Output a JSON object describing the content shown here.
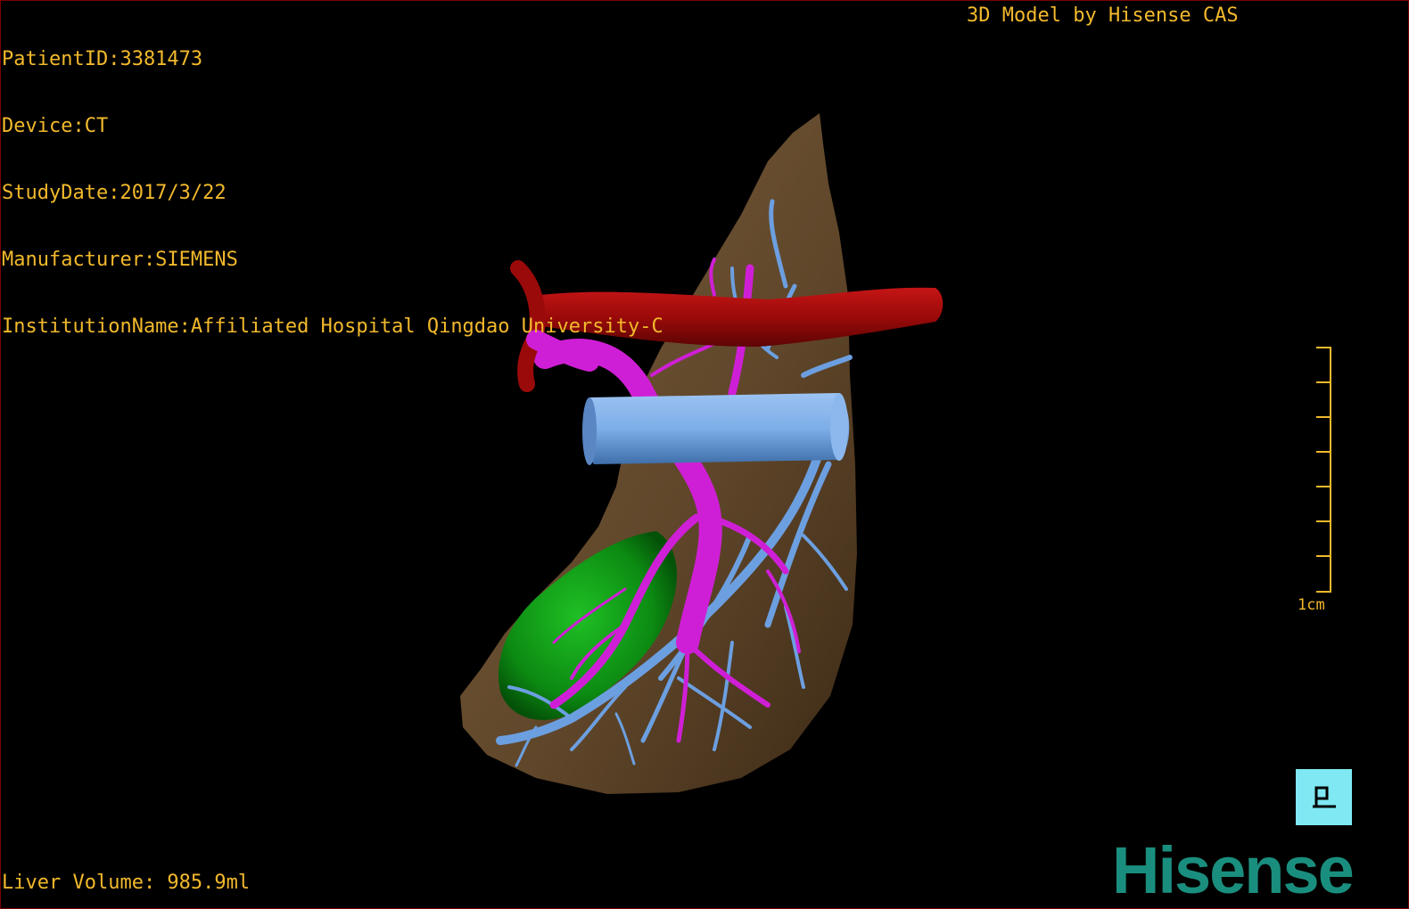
{
  "patient_info": {
    "patient_id": "PatientID:3381473",
    "device": "Device:CT",
    "study_date": "StudyDate:2017/3/22",
    "manufacturer": "Manufacturer:SIEMENS",
    "institution": "InstitutionName:Affiliated Hospital Qingdao University-C"
  },
  "model_credit": "3D Model by Hisense CAS",
  "liver_volume": "Liver Volume: 985.9ml",
  "scale_label": "1cm",
  "brand": "Hisense",
  "orientation_icon": "posterior-view-icon",
  "colors": {
    "text_overlay": "#f2b92c",
    "liver_parenchyma": "#6b5034",
    "artery": "#9b0a0a",
    "portal_vein": "#cf1fd6",
    "hepatic_vein": "#6c9fe0",
    "gallbladder": "#0c8a12",
    "orientation_button": "#7fe8f2",
    "brand_logo": "#1a8e7e"
  }
}
